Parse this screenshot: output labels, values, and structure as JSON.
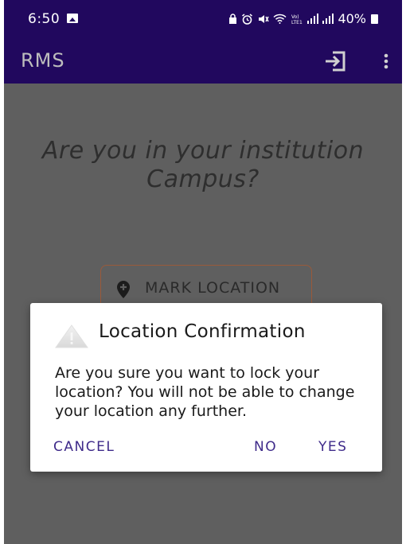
{
  "status_bar": {
    "time": "6:50",
    "icons": [
      "gallery-icon",
      "lock-icon",
      "alarm-icon",
      "mute-icon",
      "wifi-icon",
      "volte-icon",
      "signal-icon",
      "signal-icon"
    ],
    "battery": "40%"
  },
  "app_bar": {
    "title": "RMS",
    "logout_icon": "logout-icon",
    "menu_icon": "more-vert-icon"
  },
  "main": {
    "question": "Are you in your institution Campus?",
    "mark_button": {
      "label": "MARK LOCATION",
      "icon": "add-location-icon"
    }
  },
  "dialog": {
    "icon": "warning-icon",
    "title": "Location Confirmation",
    "message": "Are you sure you want to lock your location? You will not be able to change your location any further.",
    "buttons": {
      "cancel": "CANCEL",
      "no": "NO",
      "yes": "YES"
    }
  },
  "colors": {
    "app_bar": "#21085e",
    "scrim": "#5f5f5f",
    "dialog_button": "#3f2b8a",
    "button_border": "#9a5a3a"
  }
}
